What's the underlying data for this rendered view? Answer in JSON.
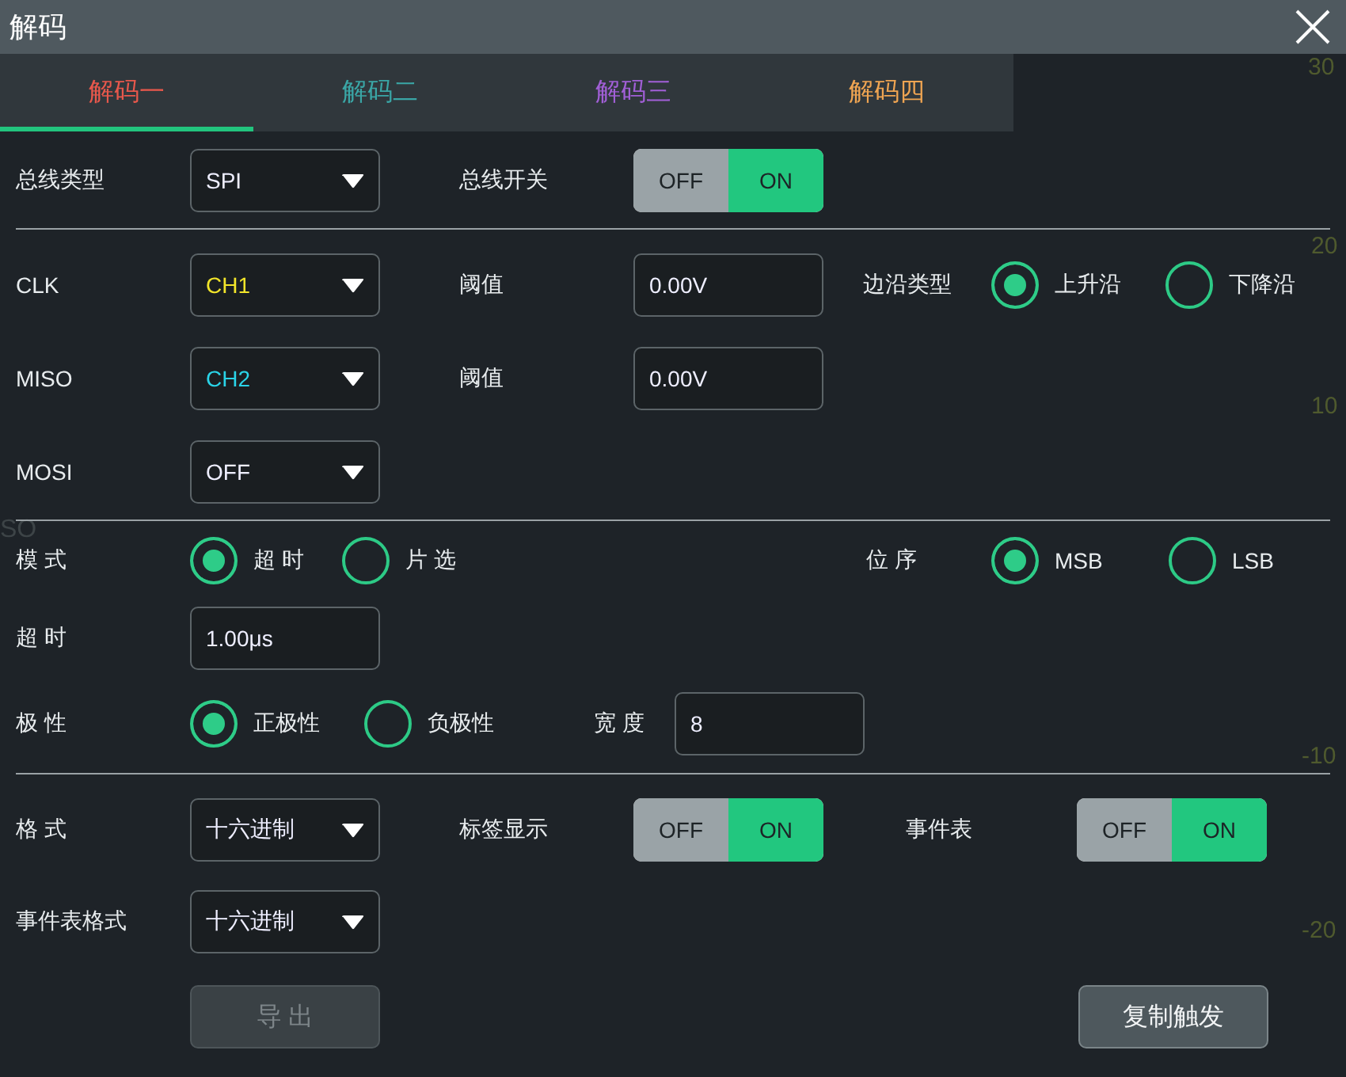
{
  "window": {
    "title": "解码"
  },
  "background": {
    "scale_labels": [
      "30",
      "20",
      "10",
      "-10",
      "-20",
      "SO"
    ]
  },
  "tabs": [
    {
      "label": "解码一",
      "selected": true,
      "color": "#e8584c"
    },
    {
      "label": "解码二",
      "selected": false,
      "color": "#3aa6a6"
    },
    {
      "label": "解码三",
      "selected": false,
      "color": "#a15fd6"
    },
    {
      "label": "解码四",
      "selected": false,
      "color": "#f0a552"
    }
  ],
  "rows": [
    {
      "kind": "fields",
      "items": [
        {
          "kind": "label",
          "text": "总线类型"
        },
        {
          "kind": "dropdown",
          "value": "SPI"
        },
        {
          "kind": "label",
          "text": "总线开关"
        },
        {
          "kind": "toggle",
          "off": "OFF",
          "on": "ON",
          "value": true
        }
      ]
    },
    {
      "kind": "divider"
    },
    {
      "kind": "fields",
      "items": [
        {
          "kind": "label",
          "text": "CLK"
        },
        {
          "kind": "dropdown",
          "value": "CH1",
          "color": "#f2e52a"
        },
        {
          "kind": "label",
          "text": "阈值"
        },
        {
          "kind": "input",
          "value": "0.00V"
        },
        {
          "kind": "label",
          "text": "边沿类型"
        },
        {
          "kind": "radio",
          "text": "上升沿",
          "selected": true
        },
        {
          "kind": "radio",
          "text": "下降沿",
          "selected": false
        }
      ]
    },
    {
      "kind": "fields",
      "items": [
        {
          "kind": "label",
          "text": "MISO"
        },
        {
          "kind": "dropdown",
          "value": "CH2",
          "color": "#2ad4e8"
        },
        {
          "kind": "label",
          "text": "阈值"
        },
        {
          "kind": "input",
          "value": "0.00V"
        }
      ]
    },
    {
      "kind": "fields",
      "items": [
        {
          "kind": "label",
          "text": "MOSI"
        },
        {
          "kind": "dropdown",
          "value": "OFF"
        }
      ]
    },
    {
      "kind": "divider"
    },
    {
      "kind": "fields",
      "items": [
        {
          "kind": "label",
          "text": "模 式"
        },
        {
          "kind": "radio",
          "text": "超 时",
          "selected": true
        },
        {
          "kind": "radio",
          "text": "片 选",
          "selected": false
        },
        {
          "kind": "label",
          "text": "位 序"
        },
        {
          "kind": "radio",
          "text": "MSB",
          "selected": true
        },
        {
          "kind": "radio",
          "text": "LSB",
          "selected": false
        }
      ]
    },
    {
      "kind": "fields",
      "items": [
        {
          "kind": "label",
          "text": "超 时"
        },
        {
          "kind": "input",
          "value": "1.00μs"
        }
      ]
    },
    {
      "kind": "fields",
      "items": [
        {
          "kind": "label",
          "text": "极 性"
        },
        {
          "kind": "radio",
          "text": "正极性",
          "selected": true
        },
        {
          "kind": "radio",
          "text": "负极性",
          "selected": false
        },
        {
          "kind": "label",
          "text": "宽 度"
        },
        {
          "kind": "input",
          "value": "8"
        }
      ]
    },
    {
      "kind": "divider"
    },
    {
      "kind": "fields",
      "items": [
        {
          "kind": "label",
          "text": "格 式"
        },
        {
          "kind": "dropdown",
          "value": "十六进制"
        },
        {
          "kind": "label",
          "text": "标签显示"
        },
        {
          "kind": "toggle",
          "off": "OFF",
          "on": "ON",
          "value": true
        },
        {
          "kind": "label",
          "text": "事件表"
        },
        {
          "kind": "toggle",
          "off": "OFF",
          "on": "ON",
          "value": true
        }
      ]
    },
    {
      "kind": "fields",
      "items": [
        {
          "kind": "label",
          "text": "事件表格式"
        },
        {
          "kind": "dropdown",
          "value": "十六进制"
        }
      ]
    },
    {
      "kind": "fields",
      "items": [
        {
          "kind": "button",
          "text": "导 出",
          "disabled": true
        },
        {
          "kind": "button",
          "text": "复制触发",
          "disabled": false
        }
      ]
    }
  ]
}
